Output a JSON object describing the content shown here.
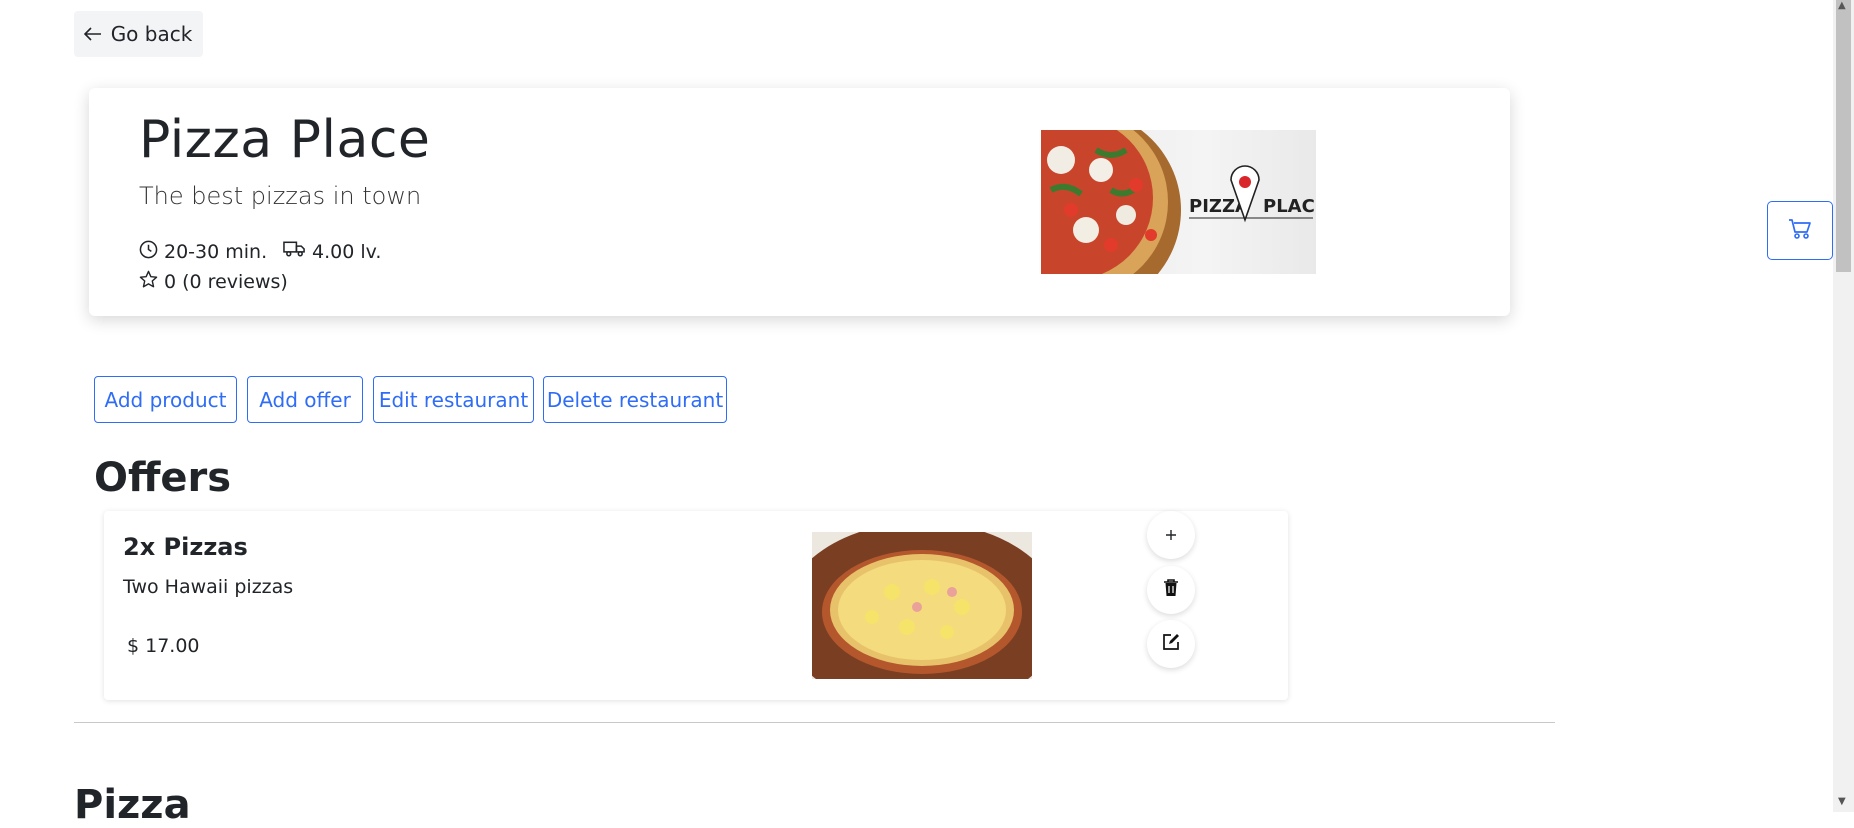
{
  "header": {
    "back_label": "Go back"
  },
  "restaurant": {
    "name": "Pizza Place",
    "description": "The best pizzas in town",
    "delivery_time": "20-30 min.",
    "delivery_fee": "4.00 lv.",
    "rating": "0 (0 reviews)",
    "logo_text_left": "PIZZA",
    "logo_text_right": "PLACE"
  },
  "actions": {
    "add_product": "Add product",
    "add_offer": "Add offer",
    "edit_restaurant": "Edit restaurant",
    "delete_restaurant": "Delete restaurant"
  },
  "offers": {
    "title": "Offers",
    "items": [
      {
        "title": "2x Pizzas",
        "description": "Two Hawaii pizzas",
        "price": "$ 17.00"
      }
    ]
  },
  "sections": [
    {
      "title": "Pizza"
    }
  ],
  "colors": {
    "accent": "#2f6df6",
    "text": "#212529",
    "back_button_bg": "#f3f4f6"
  },
  "icons": [
    "arrow-left-icon",
    "clock-icon",
    "truck-icon",
    "star-icon",
    "cart-icon",
    "plus-icon",
    "trash-icon",
    "edit-icon"
  ]
}
